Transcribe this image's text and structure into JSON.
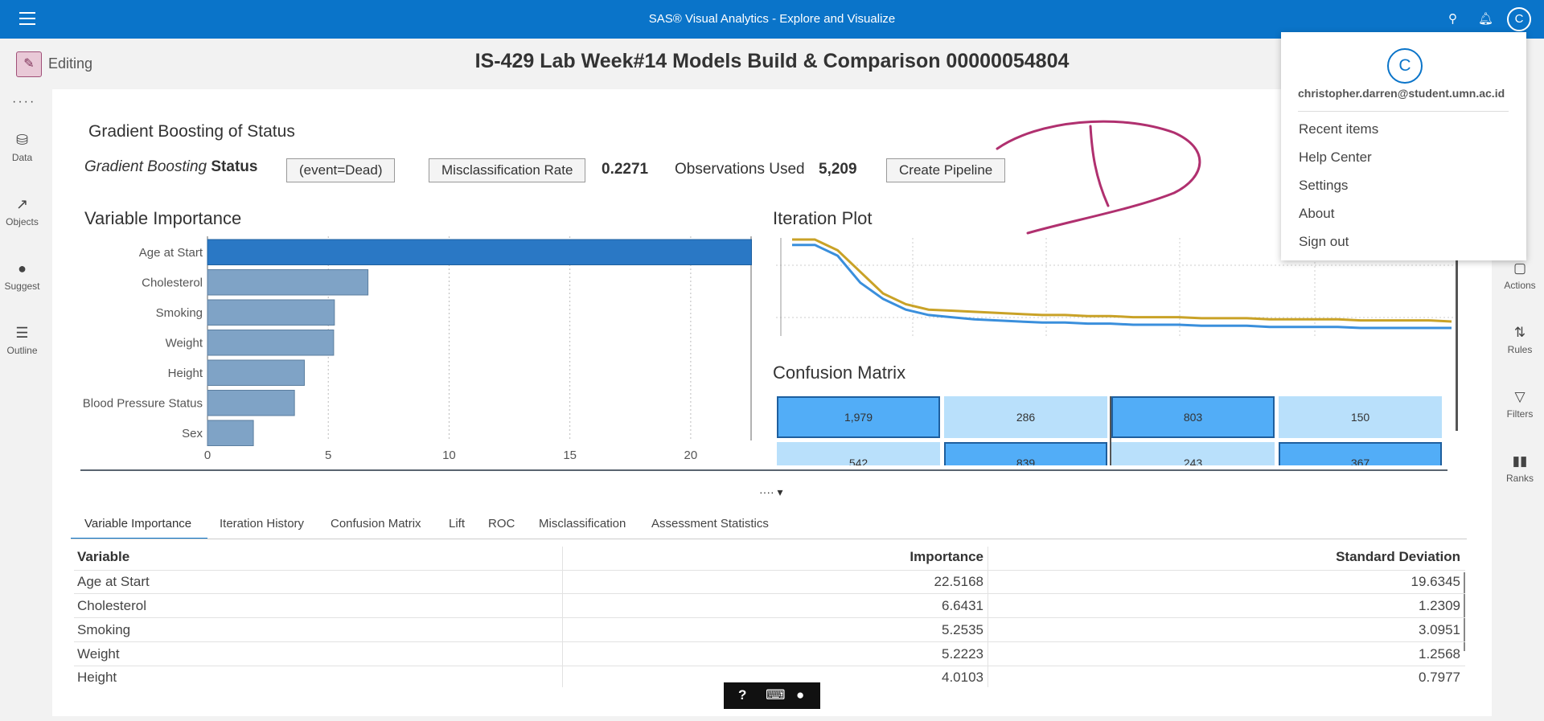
{
  "app": {
    "title": "SAS® Visual Analytics - Explore and Visualize",
    "user_initial": "C"
  },
  "subbar": {
    "edit_label": "Editing",
    "report_title": "IS-429 Lab Week#14 Models Build & Comparison 00000054804"
  },
  "left_rail": [
    {
      "label": "Data",
      "icon": "database-icon"
    },
    {
      "label": "Objects",
      "icon": "chart-icon"
    },
    {
      "label": "Suggest",
      "icon": "lightbulb-icon"
    },
    {
      "label": "Outline",
      "icon": "list-icon"
    }
  ],
  "right_rail": [
    {
      "label": "Actions",
      "icon": "cursor-icon"
    },
    {
      "label": "Rules",
      "icon": "rules-icon"
    },
    {
      "label": "Filters",
      "icon": "filter-icon"
    },
    {
      "label": "Ranks",
      "icon": "ranks-icon"
    }
  ],
  "object": {
    "title": "Gradient Boosting of Status",
    "model_type": "Gradient Boosting",
    "target": "Status",
    "event": "(event=Dead)",
    "metric_label": "Misclassification Rate",
    "metric_value": "0.2271",
    "obs_label": "Observations Used",
    "obs_value": "5,209",
    "pipeline_button": "Create Pipeline"
  },
  "variable_importance_title": "Variable Importance",
  "iteration_plot_title": "Iteration Plot",
  "confusion_matrix_title": "Confusion Matrix",
  "chart_data": [
    {
      "type": "bar",
      "orientation": "horizontal",
      "title": "Variable Importance",
      "categories": [
        "Age at Start",
        "Cholesterol",
        "Smoking",
        "Weight",
        "Height",
        "Blood Pressure Status",
        "Sex"
      ],
      "values": [
        22.5168,
        6.6431,
        5.2535,
        5.2223,
        4.0103,
        3.6,
        1.9
      ],
      "xticks": [
        "0",
        "5",
        "10",
        "15",
        "20"
      ],
      "xlim": [
        0,
        22.5
      ]
    },
    {
      "type": "line",
      "title": "Iteration Plot",
      "series": [
        {
          "color": "#c9a227",
          "values": [
            0.31,
            0.31,
            0.3,
            0.28,
            0.26,
            0.25,
            0.245,
            0.244,
            0.243,
            0.242,
            0.241,
            0.24,
            0.24,
            0.239,
            0.239,
            0.238,
            0.238,
            0.238,
            0.237,
            0.237,
            0.237,
            0.236,
            0.236,
            0.236,
            0.236,
            0.235,
            0.235,
            0.235,
            0.235,
            0.234
          ]
        },
        {
          "color": "#3a8fdc",
          "values": [
            0.305,
            0.305,
            0.295,
            0.27,
            0.255,
            0.245,
            0.24,
            0.238,
            0.236,
            0.235,
            0.234,
            0.233,
            0.233,
            0.232,
            0.232,
            0.231,
            0.231,
            0.231,
            0.23,
            0.23,
            0.23,
            0.229,
            0.229,
            0.229,
            0.229,
            0.228,
            0.228,
            0.228,
            0.228,
            0.228
          ]
        }
      ]
    },
    {
      "type": "heatmap",
      "title": "Confusion Matrix",
      "cells": [
        [
          "1,979",
          "286",
          "803",
          "150"
        ],
        [
          "542",
          "839",
          "243",
          "367"
        ]
      ]
    }
  ],
  "tabs": [
    "Variable Importance",
    "Iteration History",
    "Confusion Matrix",
    "Lift",
    "ROC",
    "Misclassification",
    "Assessment Statistics"
  ],
  "table": {
    "headers": [
      "Variable",
      "Importance",
      "Standard Deviation"
    ],
    "rows": [
      [
        "Age at Start",
        "22.5168",
        "19.6345"
      ],
      [
        "Cholesterol",
        "6.6431",
        "1.2309"
      ],
      [
        "Smoking",
        "5.2535",
        "3.0951"
      ],
      [
        "Weight",
        "5.2223",
        "1.2568"
      ],
      [
        "Height",
        "4.0103",
        "0.7977"
      ]
    ]
  },
  "user_menu": {
    "initial": "C",
    "email": "christopher.darren@student.umn.ac.id",
    "items": [
      "Recent items",
      "Help Center",
      "Settings",
      "About",
      "Sign out"
    ]
  },
  "help_bar": {
    "icons": [
      "help-icon",
      "keyboard-icon",
      "chat-icon"
    ]
  },
  "colors": {
    "accent": "#0a74c9",
    "bar": "#7fa3c6",
    "bar_highlight": "#2a78c5",
    "annotation": "#b0306f"
  }
}
